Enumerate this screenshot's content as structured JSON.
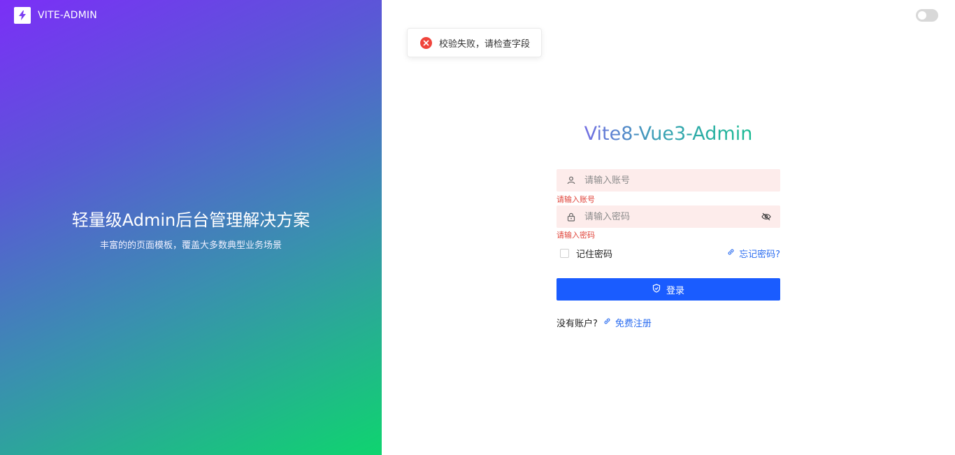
{
  "brand": {
    "name": "VITE-ADMIN",
    "logo_icon": "bolt-icon"
  },
  "hero": {
    "title": "轻量级Admin后台管理解决方案",
    "subtitle": "丰富的的页面模板，覆盖大多数典型业务场景"
  },
  "toast": {
    "message": "校验失败，请检查字段",
    "type": "error"
  },
  "login": {
    "title": "Vite8-Vue3-Admin",
    "username": {
      "placeholder": "请输入账号",
      "value": "",
      "error": "请输入账号",
      "icon": "user-icon"
    },
    "password": {
      "placeholder": "请输入密码",
      "value": "",
      "error": "请输入密码",
      "icon": "lock-icon",
      "toggle_icon": "eye-off-icon"
    },
    "remember_label": "记住密码",
    "forgot_label": "忘记密码?",
    "submit_label": "登录",
    "no_account_label": "没有账户?",
    "register_label": "免费注册"
  },
  "colors": {
    "primary": "#1a5cff",
    "link": "#2a6cf0",
    "error": "#e0443a",
    "gradient_start": "#7b2ff7",
    "gradient_end": "#0fd46f"
  }
}
